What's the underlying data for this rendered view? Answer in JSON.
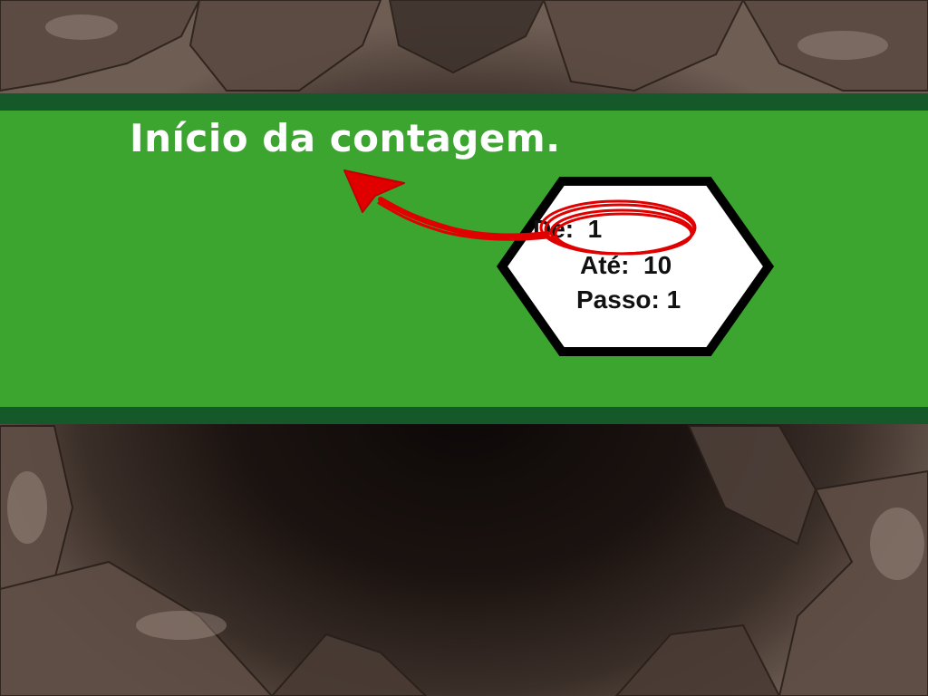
{
  "scene": {
    "heading": "Início da contagem.",
    "counter_box": {
      "from_label": "De:  1",
      "to_label": "Até:  10",
      "step_label": "Passo: 1"
    },
    "annotation": {
      "color": "#e00000",
      "highlights": "counter_box.from_label",
      "points_to": "heading"
    }
  },
  "colors": {
    "banner_green": "#3ba530",
    "banner_edge": "#15592a",
    "hexagon_fill": "#ffffff",
    "hexagon_stroke": "#000000",
    "text_light": "#ffffff",
    "text_dark": "#111111"
  }
}
